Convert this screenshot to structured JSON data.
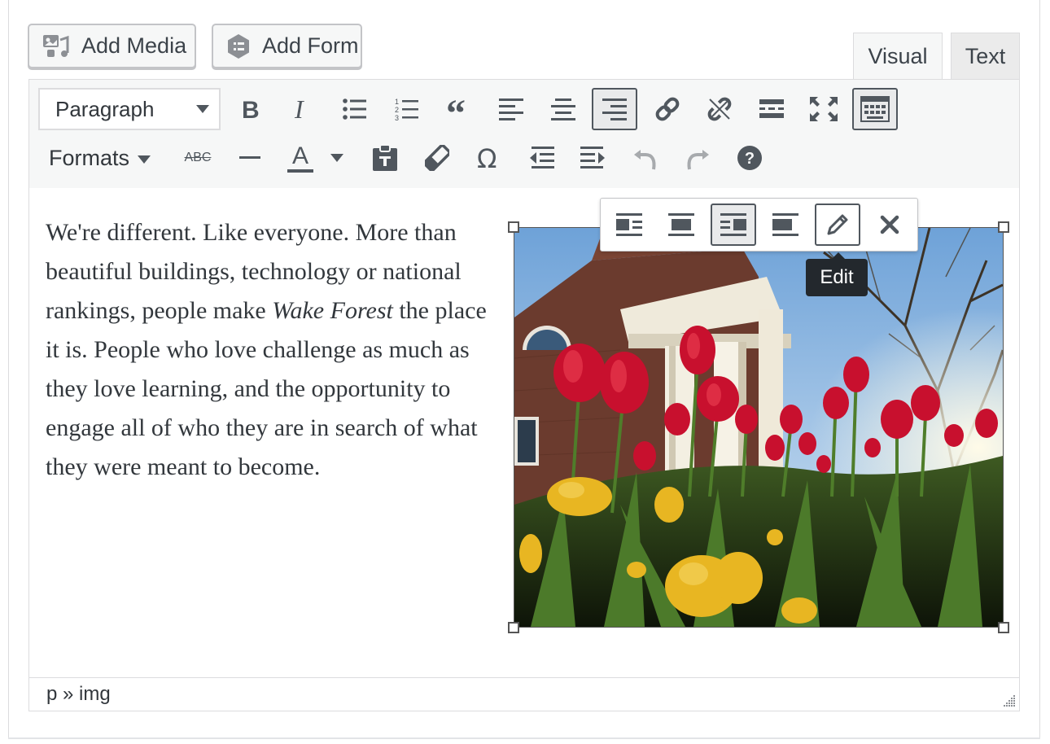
{
  "media_buttons": {
    "add_media": "Add Media",
    "add_form": "Add Form"
  },
  "tabs": {
    "visual": "Visual",
    "text": "Text",
    "active": "Visual"
  },
  "toolbar": {
    "format_select": "Paragraph",
    "formats_menu": "Formats",
    "row1_icons": [
      "bold-icon",
      "italic-icon",
      "bullet-list-icon",
      "numbered-list-icon",
      "blockquote-icon",
      "align-left-icon",
      "align-center-icon",
      "align-right-icon",
      "insert-link-icon",
      "remove-link-icon",
      "read-more-icon",
      "fullscreen-icon",
      "toolbar-toggle-icon"
    ],
    "row1_active": [
      "align-right-icon",
      "toolbar-toggle-icon"
    ],
    "row2_icons": [
      "strikethrough-icon",
      "horizontal-line-icon",
      "text-color-icon",
      "paste-as-text-icon",
      "clear-formatting-icon",
      "special-character-icon",
      "outdent-icon",
      "indent-icon",
      "undo-icon",
      "redo-icon",
      "help-icon"
    ],
    "strikethrough_label": "ABC",
    "text_color_label": "A"
  },
  "editor": {
    "text_before_italic": "We're different. Like everyone. More than beautiful buildings, technology or national rankings, people make ",
    "italic_text": "Wake Forest",
    "text_after_italic": " the place it is. People who love challenge as much as they love learning, and the opportunity to engage all of who they are in search of what they were meant to become."
  },
  "image_toolbar": {
    "icons": [
      "align-left-icon",
      "align-center-icon",
      "align-right-icon",
      "align-none-icon",
      "edit-icon",
      "remove-icon"
    ],
    "active": "align-right-icon",
    "focused": "edit-icon",
    "tooltip": "Edit"
  },
  "statusbar": {
    "path": "p » img"
  },
  "colors": {
    "accent": "#50575e",
    "toolbar_bg": "#f6f7f7",
    "border": "#dcdcde",
    "tooltip_bg": "#23282d"
  }
}
